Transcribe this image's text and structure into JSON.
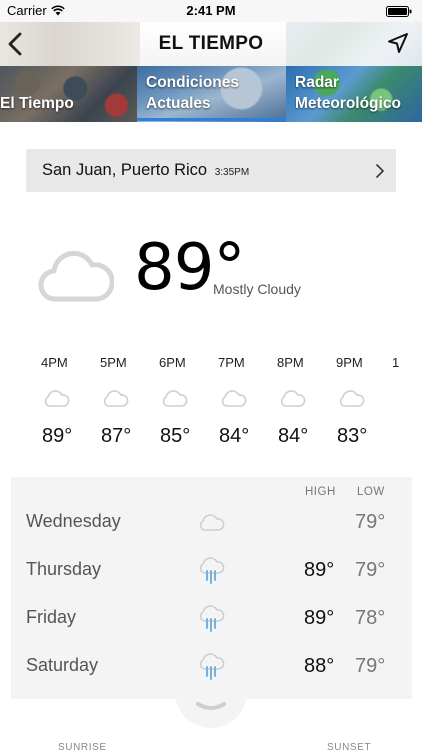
{
  "status_bar": {
    "carrier": "Carrier",
    "time": "2:41 PM"
  },
  "nav": {
    "title": "EL TIEMPO"
  },
  "tabs": [
    {
      "label_line1": "",
      "label_line2": "El Tiempo"
    },
    {
      "label_line1": "Condiciones",
      "label_line2": "Actuales"
    },
    {
      "label_line1": "Radar",
      "label_line2": "Meteorológico"
    }
  ],
  "location": {
    "name": "San Juan, Puerto Rico",
    "time": "3:35PM"
  },
  "current": {
    "temp": "89°",
    "condition": "Mostly Cloudy",
    "icon": "cloud-icon"
  },
  "hourly": [
    {
      "time": "4PM",
      "temp": "89°",
      "icon": "cloud-icon"
    },
    {
      "time": "5PM",
      "temp": "87°",
      "icon": "cloud-icon"
    },
    {
      "time": "6PM",
      "temp": "85°",
      "icon": "cloud-icon"
    },
    {
      "time": "7PM",
      "temp": "84°",
      "icon": "cloud-icon"
    },
    {
      "time": "8PM",
      "temp": "84°",
      "icon": "cloud-icon"
    },
    {
      "time": "9PM",
      "temp": "83°",
      "icon": "cloud-icon"
    },
    {
      "time": "1",
      "temp": "",
      "icon": "cloud-icon"
    }
  ],
  "daily": {
    "high_label": "HIGH",
    "low_label": "LOW",
    "days": [
      {
        "name": "Wednesday",
        "high": "",
        "low": "79°",
        "icon": "cloud-icon"
      },
      {
        "name": "Thursday",
        "high": "89°",
        "low": "79°",
        "icon": "rain-cloud-icon"
      },
      {
        "name": "Friday",
        "high": "89°",
        "low": "78°",
        "icon": "rain-cloud-icon"
      },
      {
        "name": "Saturday",
        "high": "88°",
        "low": "79°",
        "icon": "rain-cloud-icon"
      }
    ]
  },
  "footer": {
    "sunrise_label": "SUNRISE",
    "sunset_label": "SUNSET"
  },
  "colors": {
    "accent": "#2b7fe0",
    "rain": "#6fb3e0",
    "cloud": "#d6d6d6"
  }
}
